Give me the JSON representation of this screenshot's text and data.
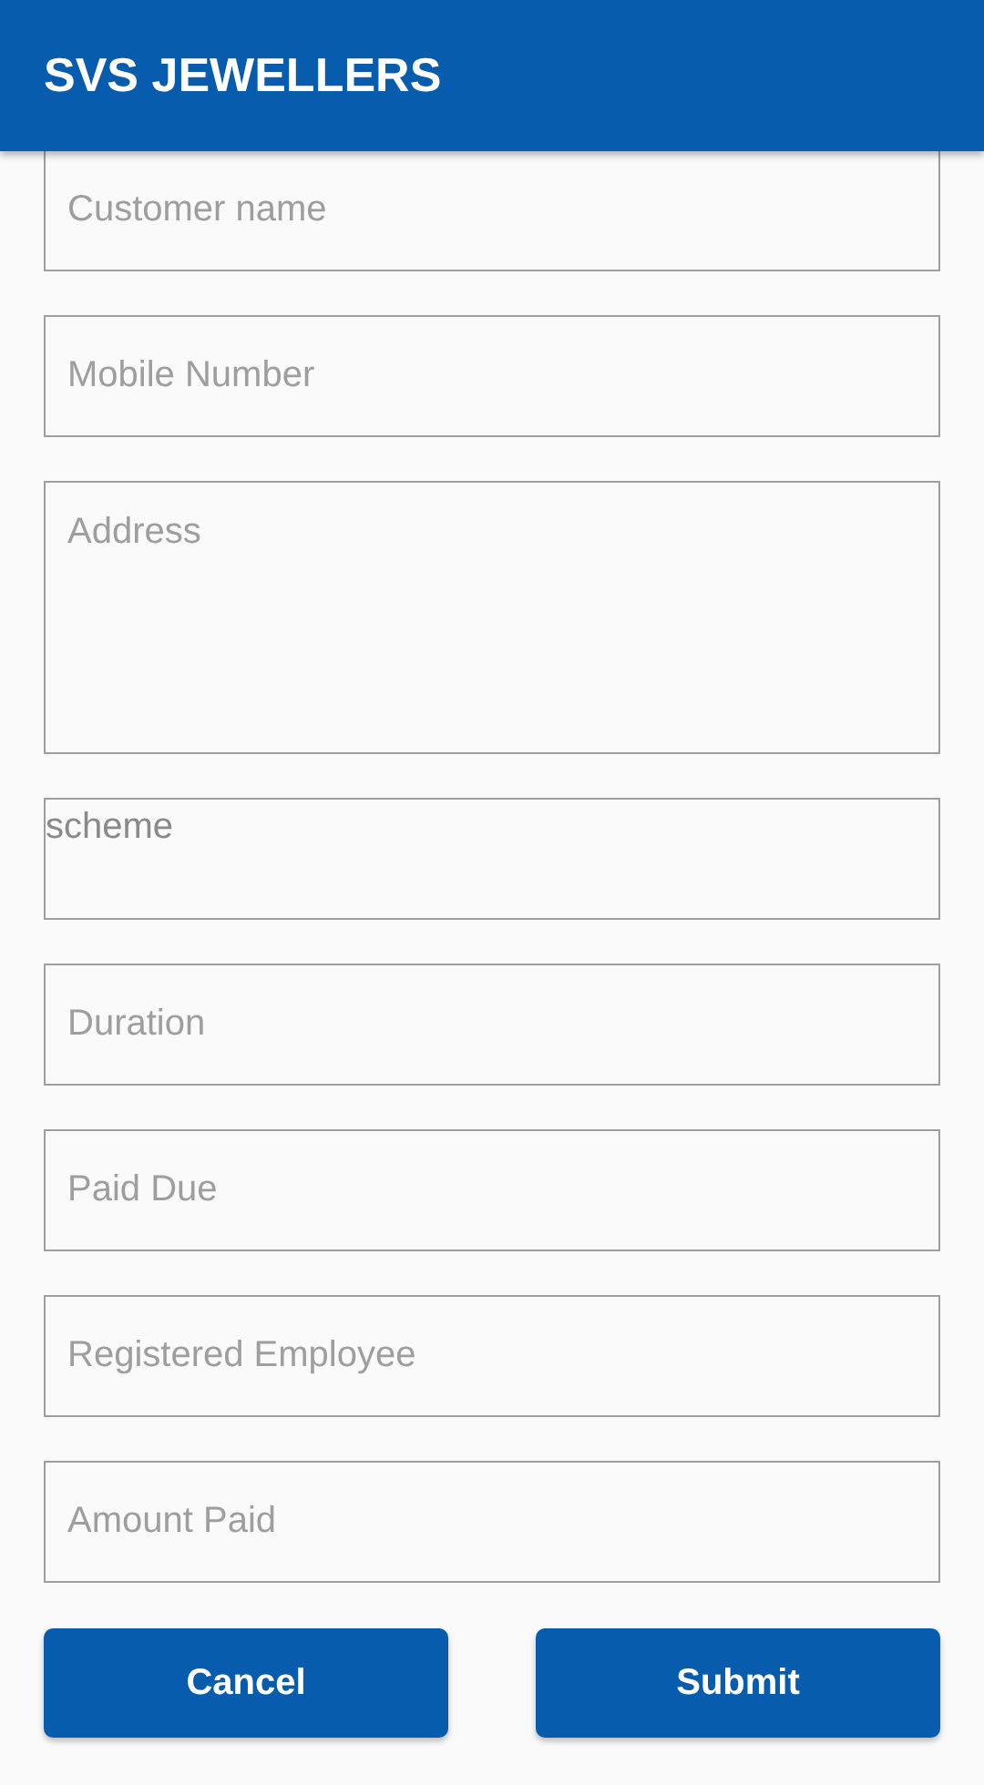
{
  "app_bar": {
    "title": "SVS JEWELLERS"
  },
  "fields": [
    {
      "kind": "text",
      "placeholder": "Customer name"
    },
    {
      "kind": "text",
      "placeholder": "Mobile Number"
    },
    {
      "kind": "textarea",
      "placeholder": "Address"
    },
    {
      "kind": "select",
      "value": "scheme"
    },
    {
      "kind": "text",
      "placeholder": "Duration"
    },
    {
      "kind": "text",
      "placeholder": "Paid Due"
    },
    {
      "kind": "text",
      "placeholder": "Registered Employee"
    },
    {
      "kind": "text",
      "placeholder": "Amount Paid"
    }
  ],
  "buttons": [
    {
      "label": "Cancel"
    },
    {
      "label": "Submit"
    }
  ]
}
